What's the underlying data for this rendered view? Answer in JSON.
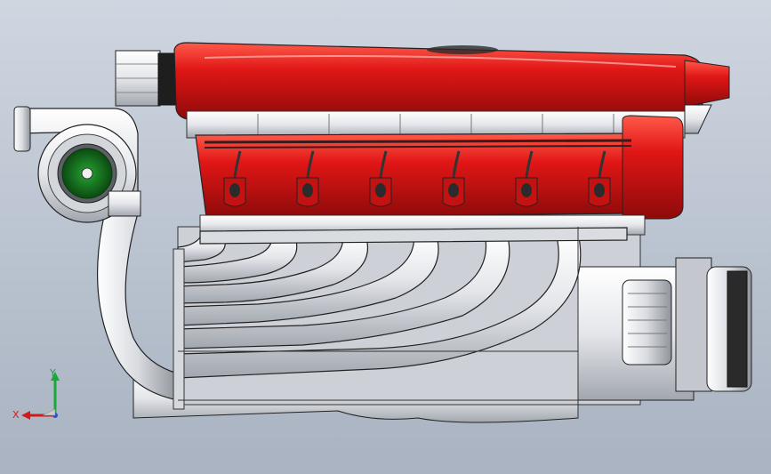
{
  "viewport": {
    "background": "#b9c2cf"
  },
  "model": {
    "colors": {
      "intake": "#e01616",
      "intake_dark": "#8e0a0a",
      "metal": "#e8e9ec",
      "metal_shade": "#9da1a8",
      "outline": "#222222",
      "turbo_wheel": "#1f8f2a"
    }
  },
  "triad": {
    "x_label": "X",
    "y_label": "Y",
    "x_color": "#d21a1a",
    "y_color": "#19a83a",
    "z_color": "#2a4fd6"
  }
}
